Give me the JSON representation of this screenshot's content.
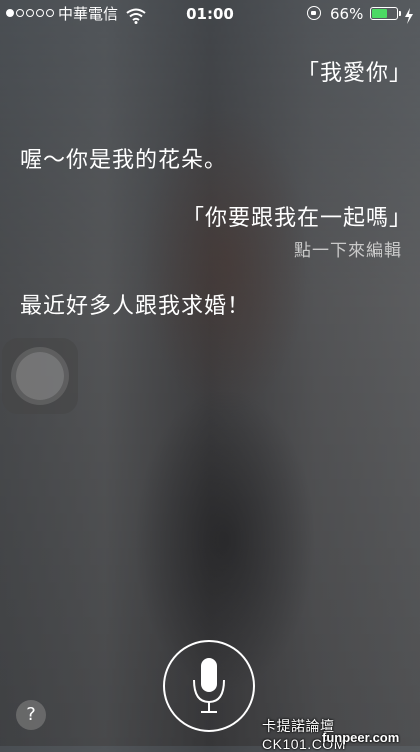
{
  "status_bar": {
    "signal_bars_filled": 1,
    "signal_bars_total": 5,
    "carrier": "中華電信",
    "time": "01:00",
    "battery_percent_label": "66%",
    "battery_level": 0.66,
    "battery_color": "#4cd964",
    "icons": [
      "wifi-icon",
      "rotation-lock-icon",
      "battery-icon",
      "charging-icon"
    ]
  },
  "conversation": {
    "user_query_1": "「我愛你」",
    "siri_reply_1": "喔～你是我的花朵。",
    "user_query_2": "「你要跟我在一起嗎」",
    "tap_to_edit_hint": "點一下來編輯",
    "siri_reply_2": "最近好多人跟我求婚！"
  },
  "controls": {
    "help_label": "?",
    "mic_icon": "microphone-icon",
    "assistive_touch_icon": "assistive-touch-icon"
  },
  "watermark": {
    "line1": "卡提諾論壇 CK101.COM",
    "line2": "funpeer.com"
  }
}
